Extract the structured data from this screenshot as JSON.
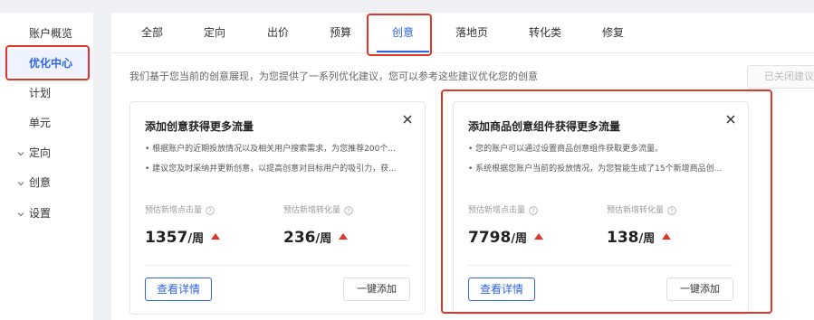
{
  "sidebar": {
    "items": [
      {
        "label": "账户概览"
      },
      {
        "label": "优化中心"
      },
      {
        "label": "计划"
      },
      {
        "label": "单元"
      },
      {
        "label": "定向"
      },
      {
        "label": "创意"
      },
      {
        "label": "设置"
      }
    ]
  },
  "tabs": [
    {
      "label": "全部"
    },
    {
      "label": "定向"
    },
    {
      "label": "出价"
    },
    {
      "label": "预算"
    },
    {
      "label": "创意"
    },
    {
      "label": "落地页"
    },
    {
      "label": "转化类"
    },
    {
      "label": "修复"
    }
  ],
  "active_tab": "创意",
  "intro_text": "我们基于您当前的创意展现，为您提供了一系列优化建议，您可以参考这些建议优化您的创意",
  "closed_button_label": "已关闭建议",
  "cards": [
    {
      "title": "添加创意获得更多流量",
      "bullets": [
        "• 根据账户的近期投放情况以及相关用户搜索需求，为您推荐200个...",
        "• 建议您及时采纳并更新创意，以提高创意对目标用户的吸引力，获..."
      ],
      "metric1_label": "预估新增点击量",
      "metric1_value": "1357",
      "metric1_unit": "/周",
      "metric2_label": "预估新增转化量",
      "metric2_value": "236",
      "metric2_unit": "/周",
      "detail_label": "查看详情",
      "add_label": "一键添加"
    },
    {
      "title": "添加商品创意组件获得更多流量",
      "bullets": [
        "• 您的账户可以通过设置商品创意组件获取更多流量。",
        "• 系统根据您账户当前的投放情况，为您智能生成了15个新增商品创..."
      ],
      "metric1_label": "预估新增点击量",
      "metric1_value": "7798",
      "metric1_unit": "/周",
      "metric2_label": "预估新增转化量",
      "metric2_value": "138",
      "metric2_unit": "/周",
      "detail_label": "查看详情",
      "add_label": "一键添加"
    }
  ],
  "colors": {
    "accent": "#2f64e3",
    "highlight_box": "#e0352b",
    "trend_up": "#e0352b"
  }
}
